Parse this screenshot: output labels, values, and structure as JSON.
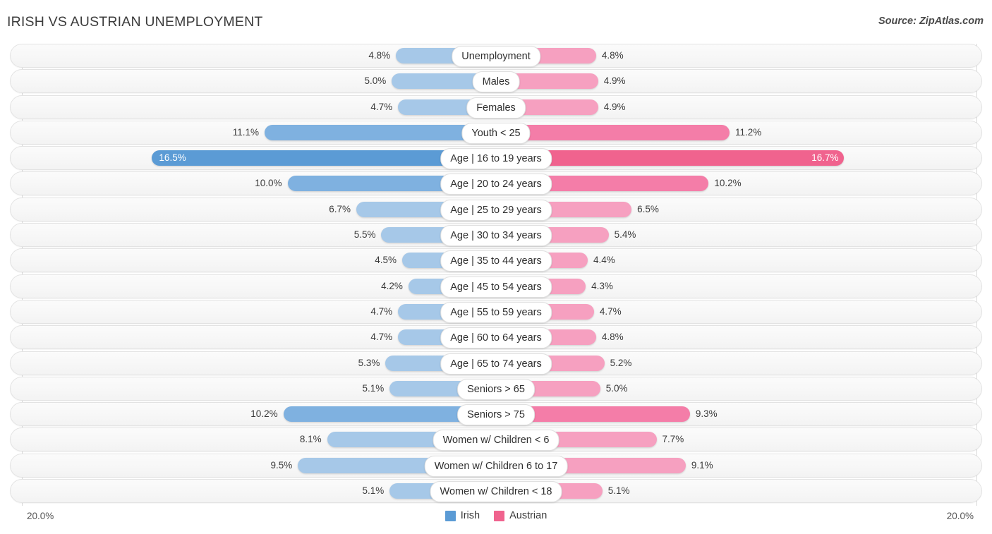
{
  "header": {
    "title": "IRISH VS AUSTRIAN UNEMPLOYMENT",
    "source": "Source: ZipAtlas.com"
  },
  "legend": {
    "items": [
      {
        "label": "Irish",
        "color": "#5b9bd5"
      },
      {
        "label": "Austrian",
        "color": "#f0638e"
      }
    ]
  },
  "axis": {
    "left_max_label": "20.0%",
    "right_max_label": "20.0%"
  },
  "colors": {
    "left_light": "#a6c8e8",
    "left_mid": "#7fb1e0",
    "left_dark": "#5b9bd5",
    "right_light": "#f6a0c0",
    "right_mid": "#f47da8",
    "right_dark": "#f0638e",
    "track_fill": "#f7f7f7",
    "track_border": "#e3e3e3"
  },
  "chart_data": {
    "type": "bar",
    "title": "IRISH VS AUSTRIAN UNEMPLOYMENT",
    "subtitle": "",
    "orientation": "horizontal-diverging",
    "xlabel": "",
    "ylabel": "",
    "xlim": [
      20.0,
      20.0
    ],
    "axis_max": 20.0,
    "unit": "%",
    "grid": false,
    "legend_position": "bottom-center",
    "categories": [
      "Unemployment",
      "Males",
      "Females",
      "Youth < 25",
      "Age | 16 to 19 years",
      "Age | 20 to 24 years",
      "Age | 25 to 29 years",
      "Age | 30 to 34 years",
      "Age | 35 to 44 years",
      "Age | 45 to 54 years",
      "Age | 55 to 59 years",
      "Age | 60 to 64 years",
      "Age | 65 to 74 years",
      "Seniors > 65",
      "Seniors > 75",
      "Women w/ Children < 6",
      "Women w/ Children 6 to 17",
      "Women w/ Children < 18"
    ],
    "series": [
      {
        "name": "Irish",
        "color": "#5b9bd5",
        "side": "left",
        "values": [
          4.8,
          5.0,
          4.7,
          11.1,
          16.5,
          10.0,
          6.7,
          5.5,
          4.5,
          4.2,
          4.7,
          4.7,
          5.3,
          5.1,
          10.2,
          8.1,
          9.5,
          5.1
        ],
        "labels": [
          "4.8%",
          "5.0%",
          "4.7%",
          "11.1%",
          "16.5%",
          "10.0%",
          "6.7%",
          "5.5%",
          "4.5%",
          "4.2%",
          "4.7%",
          "4.7%",
          "5.3%",
          "5.1%",
          "10.2%",
          "8.1%",
          "9.5%",
          "5.1%"
        ]
      },
      {
        "name": "Austrian",
        "color": "#f0638e",
        "side": "right",
        "values": [
          4.8,
          4.9,
          4.9,
          11.2,
          16.7,
          10.2,
          6.5,
          5.4,
          4.4,
          4.3,
          4.7,
          4.8,
          5.2,
          5.0,
          9.3,
          7.7,
          9.1,
          5.1
        ],
        "labels": [
          "4.8%",
          "4.9%",
          "4.9%",
          "11.2%",
          "16.7%",
          "10.2%",
          "6.5%",
          "5.4%",
          "4.4%",
          "4.3%",
          "4.7%",
          "4.8%",
          "5.2%",
          "5.0%",
          "9.3%",
          "7.7%",
          "9.1%",
          "5.1%"
        ]
      }
    ]
  }
}
